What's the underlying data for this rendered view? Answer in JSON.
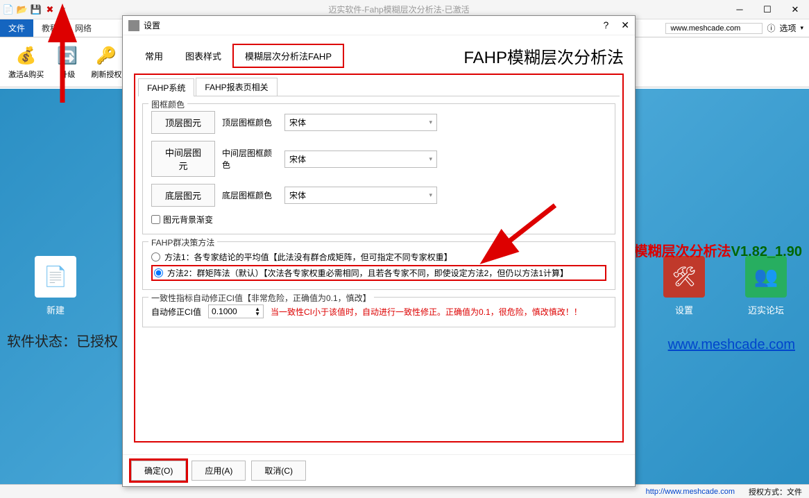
{
  "main": {
    "title": "迈实软件-Fahp模糊层次分析法-已激活",
    "ribbon_tabs": {
      "file": "文件",
      "tutorial": "教程",
      "network": "网络"
    },
    "ribbon_buttons": {
      "activate": "激活&购买",
      "upgrade": "升级",
      "refresh": "刷新授权"
    },
    "url": "www.meshcade.com",
    "options": "选项",
    "tiles": {
      "new": "新建",
      "settings": "设置",
      "forum": "迈实论坛"
    },
    "status_label": "软件状态：",
    "status_value": "已授权",
    "version_prefix": "模糊层次分析法",
    "version": "V1.82_1.90",
    "website": "www.meshcade.com",
    "statusbar_url": "http://www.meshcade.com",
    "auth_method_label": "授权方式：",
    "auth_method_value": "文件"
  },
  "dialog": {
    "title": "设置",
    "help": "?",
    "close": "✕",
    "top_tabs": {
      "common": "常用",
      "chart_style": "图表样式",
      "fahp": "模糊层次分析法FAHP"
    },
    "heading": "FAHP模糊层次分析法",
    "sub_tabs": {
      "system": "FAHP系统",
      "report": "FAHP报表页相关"
    },
    "frame_color_legend": "图框颜色",
    "layers": {
      "top": {
        "btn": "顶层图元",
        "lbl": "顶层图框颜色",
        "font": "宋体"
      },
      "mid": {
        "btn": "中间层图元",
        "lbl": "中间层图框颜色",
        "font": "宋体"
      },
      "bot": {
        "btn": "底层图元",
        "lbl": "底层图框颜色",
        "font": "宋体"
      }
    },
    "bg_gradient": "图元背景渐变",
    "group_method_legend": "FAHP群决策方法",
    "method1": "方法1：各专家结论的平均值【此法没有群合成矩阵，但可指定不同专家权重】",
    "method2": "方法2：群矩阵法（默认）【次法各专家权重必需相同，且若各专家不同，即使设定方法2，但仍以方法1计算】",
    "ci_legend": "一致性指标自动修正CI值【非常危险，正确值为0.1，慎改】",
    "ci_label": "自动修正CI值",
    "ci_value": "0.1000",
    "ci_warning": "当一致性CI小于该值时，自动进行一致性修正。正确值为0.1，很危险，慎改慎改！！",
    "buttons": {
      "ok": "确定(O)",
      "apply": "应用(A)",
      "cancel": "取消(C)"
    }
  }
}
